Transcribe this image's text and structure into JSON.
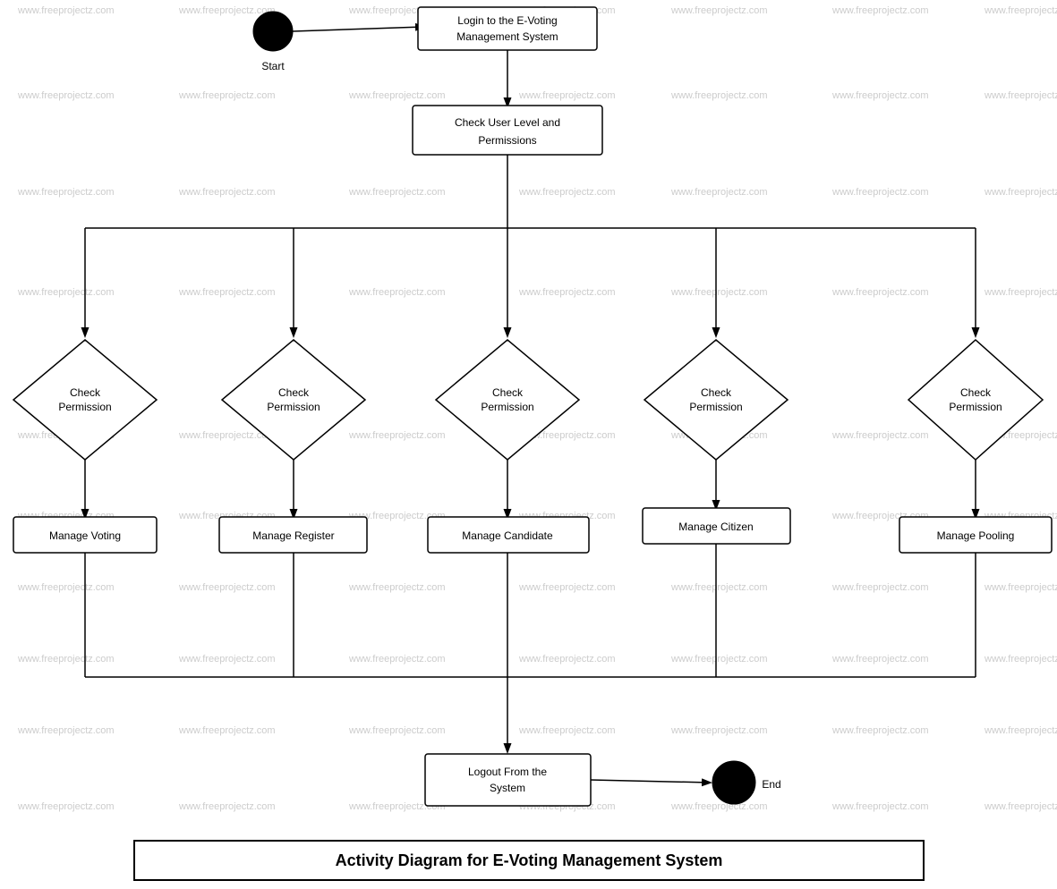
{
  "title": "Activity Diagram for E-Voting Management System",
  "nodes": {
    "start": {
      "label": "Start"
    },
    "login": {
      "label": "Login to the E-Voting\nManagement System"
    },
    "checkUserLevel": {
      "label": "Check User Level and\nPermissions"
    },
    "checkPerm1": {
      "label": "Check\nPermission"
    },
    "checkPerm2": {
      "label": "Check\nPermission"
    },
    "checkPerm3": {
      "label": "Check\nPermission"
    },
    "checkPerm4": {
      "label": "Check\nPermission"
    },
    "checkPerm5": {
      "label": "Check\nPermission"
    },
    "manageVoting": {
      "label": "Manage Voting"
    },
    "manageRegister": {
      "label": "Manage Register"
    },
    "manageCandidate": {
      "label": "Manage Candidate"
    },
    "manageCitizen": {
      "label": "Manage Citizen"
    },
    "managePooling": {
      "label": "Manage Pooling"
    },
    "logout": {
      "label": "Logout From the\nSystem"
    },
    "end": {
      "label": "End"
    }
  },
  "watermark": "www.freeprojectz.com"
}
